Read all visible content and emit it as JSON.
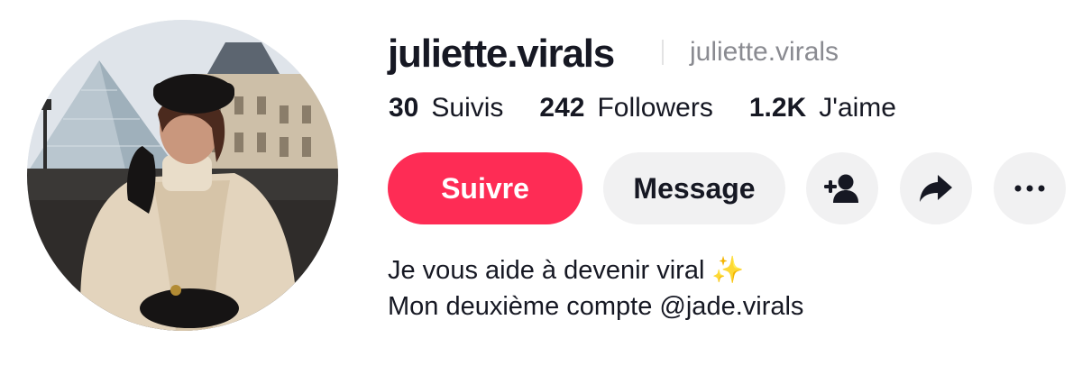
{
  "profile": {
    "username": "juliette.virals",
    "nickname": "juliette.virals",
    "avatar_alt": "profile photo",
    "stats": [
      {
        "value": "30",
        "label": "Suivis"
      },
      {
        "value": "242",
        "label": "Followers"
      },
      {
        "value": "1.2K",
        "label": "J'aime"
      }
    ],
    "actions": {
      "follow_label": "Suivre",
      "message_label": "Message",
      "add_friend_icon": "add-user-icon",
      "share_icon": "share-icon",
      "more_icon": "more-horizontal-icon"
    },
    "bio": {
      "line1": "Je vous aide à devenir viral",
      "line1_emoji": "✨",
      "line2": "Mon deuxième compte @jade.virals"
    }
  },
  "colors": {
    "follow_button": "#fe2c55",
    "secondary_button": "#f1f1f2",
    "text_primary": "#161823",
    "text_secondary": "#8a8b91"
  }
}
